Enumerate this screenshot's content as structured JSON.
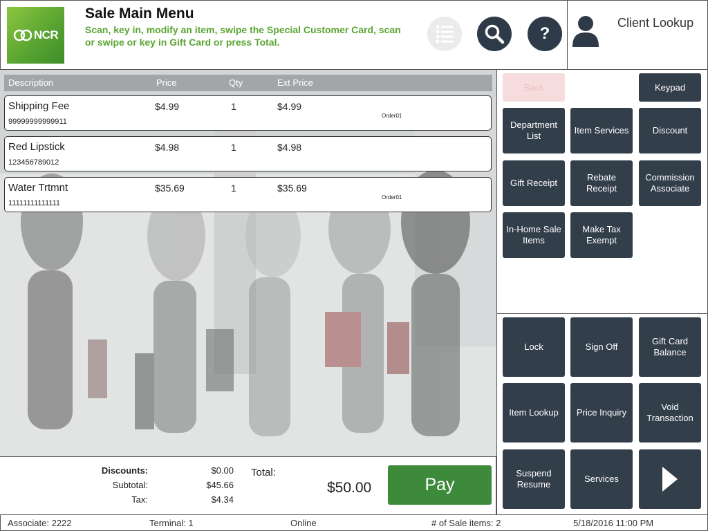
{
  "header": {
    "logo_text": "NCR",
    "title": "Sale Main Menu",
    "subtitle": "Scan, key in, modify an item, swipe the Special Customer Card, scan or swipe or key in Gift Card or press Total.",
    "help_label": "?",
    "client_lookup_label": "Client Lookup"
  },
  "table": {
    "columns": {
      "description": "Description",
      "price": "Price",
      "qty": "Qty",
      "ext_price": "Ext Price"
    },
    "rows": [
      {
        "description": "Shipping Fee",
        "sku": "99999999999911",
        "price": "$4.99",
        "qty": "1",
        "ext_price": "$4.99",
        "tag": "Order01"
      },
      {
        "description": "Red Lipstick",
        "sku": "123456789012",
        "price": "$4.98",
        "qty": "1",
        "ext_price": "$4.98",
        "tag": ""
      },
      {
        "description": "Water Trtmnt",
        "sku": "11111111111111",
        "price": "$35.69",
        "qty": "1",
        "ext_price": "$35.69",
        "tag": "Order01"
      }
    ]
  },
  "totals": {
    "discounts_label": "Discounts:",
    "discounts_value": "$0.00",
    "subtotal_label": "Subtotal:",
    "subtotal_value": "$45.66",
    "tax_label": "Tax:",
    "tax_value": "$4.34",
    "total_label": "Total:",
    "total_value": "$50.00",
    "pay_label": "Pay"
  },
  "buttons": {
    "back": "Back",
    "keypad": "Keypad",
    "department_list": "Department List",
    "item_services": "Item Services",
    "discount": "Discount",
    "gift_receipt": "Gift Receipt",
    "rebate_receipt": "Rebate Receipt",
    "commission_associate": "Commission Associate",
    "in_home_sale_items": "In-Home Sale Items",
    "make_tax_exempt": "Make Tax Exempt",
    "lock": "Lock",
    "sign_off": "Sign Off",
    "gift_card_balance": "Gift Card Balance",
    "item_lookup": "Item Lookup",
    "price_inquiry": "Price Inquiry",
    "void_transaction": "Void Transaction",
    "suspend_resume": "Suspend Resume",
    "services": "Services"
  },
  "status": {
    "associate": "Associate: 2222",
    "terminal": "Terminal: 1",
    "connection": "Online",
    "sale_items": "# of Sale items: 2",
    "datetime": "5/18/2016 11:00 PM"
  },
  "colors": {
    "dark_button": "#333e4b",
    "pay_green": "#3e8a3b",
    "brand_green": "#5aa532"
  },
  "icons": [
    "ncr-logo-icon",
    "receipt-list-icon",
    "search-icon",
    "help-icon",
    "user-icon",
    "next-arrow-icon"
  ]
}
